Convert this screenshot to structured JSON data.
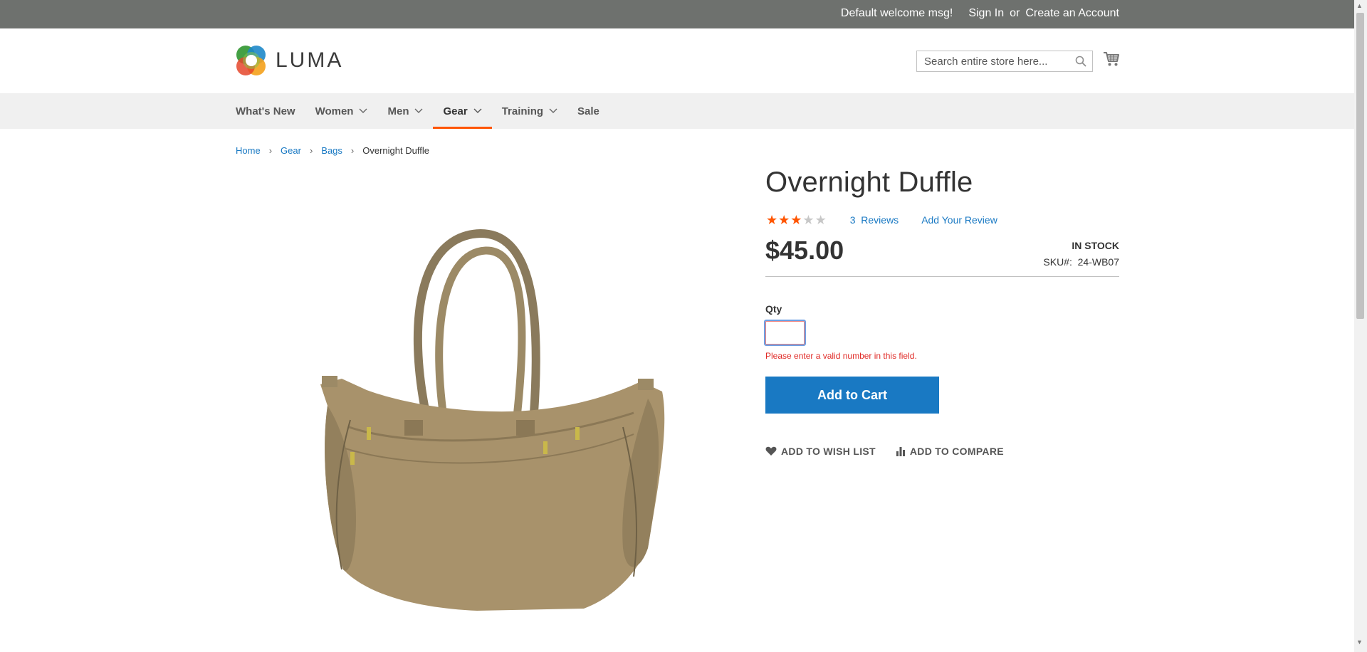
{
  "topbar": {
    "welcome": "Default welcome msg!",
    "sign_in": "Sign In",
    "or": "or",
    "create_account": "Create an Account"
  },
  "header": {
    "logo_text": "LUMA",
    "search_placeholder": "Search entire store here...",
    "icons": [
      "search-icon",
      "cart-icon"
    ]
  },
  "nav": {
    "items": [
      {
        "label": "What's New",
        "has_dropdown": false
      },
      {
        "label": "Women",
        "has_dropdown": true
      },
      {
        "label": "Men",
        "has_dropdown": true
      },
      {
        "label": "Gear",
        "has_dropdown": true,
        "active": true
      },
      {
        "label": "Training",
        "has_dropdown": true
      },
      {
        "label": "Sale",
        "has_dropdown": false
      }
    ],
    "active_color": "#ff5501"
  },
  "breadcrumb": {
    "items": [
      "Home",
      "Gear",
      "Bags"
    ],
    "current": "Overnight Duffle",
    "separator": "›"
  },
  "product": {
    "title": "Overnight Duffle",
    "rating_stars": 3,
    "max_stars": 5,
    "reviews_count": "3",
    "reviews_label": "Reviews",
    "add_review": "Add Your Review",
    "price": "$45.00",
    "stock": "In stock",
    "sku_label": "SKU#:",
    "sku": "24-WB07",
    "qty_label": "Qty",
    "qty_value": "",
    "qty_error": "Please enter a valid number in this field.",
    "add_to_cart": "Add to Cart",
    "wishlist": "Add to Wish List",
    "compare": "Add to Compare"
  },
  "colors": {
    "topbar_bg": "#6e716e",
    "link": "#1979c3",
    "button": "#1979c3",
    "error": "#e02b27",
    "star_on": "#ff5501",
    "star_off": "#c7c7c7"
  }
}
